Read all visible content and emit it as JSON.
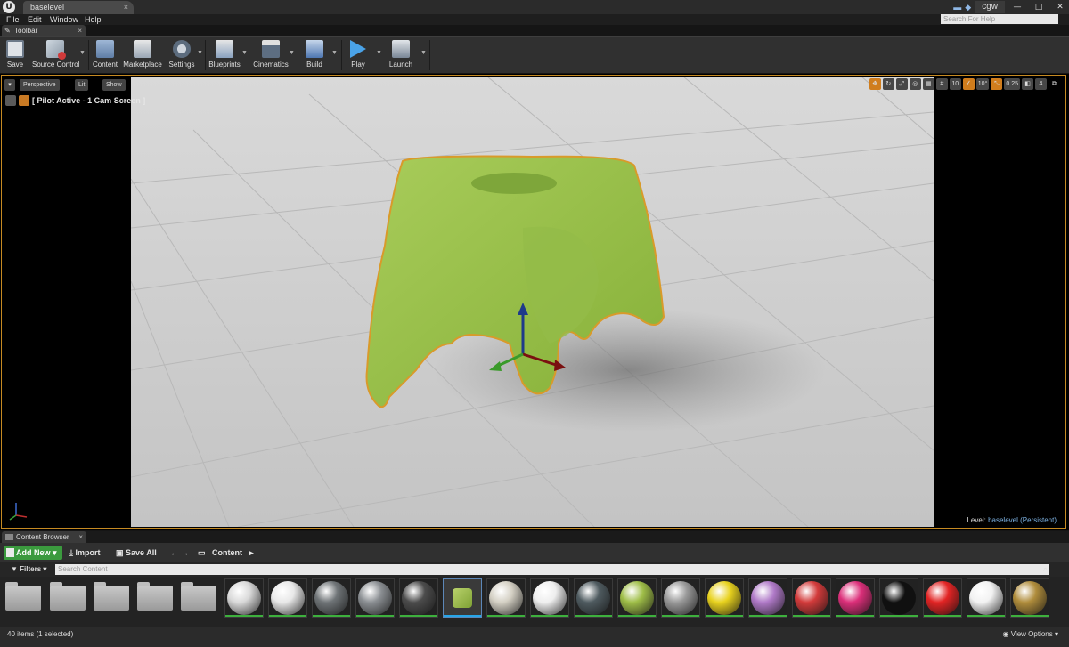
{
  "window": {
    "app_logo": "U",
    "doc_tab": "baselevel",
    "doc_tab_close": "×",
    "user": "cgw",
    "search_help_placeholder": "Search For Help",
    "minimize": "—",
    "maximize": "□",
    "close": "✕"
  },
  "menu": {
    "file": "File",
    "edit": "Edit",
    "window": "Window",
    "help": "Help"
  },
  "toolbar_tab": {
    "label": "Toolbar",
    "close": "×"
  },
  "toolbar": {
    "save": "Save",
    "source_control": "Source Control",
    "content": "Content",
    "marketplace": "Marketplace",
    "settings": "Settings",
    "blueprints": "Blueprints",
    "cinematics": "Cinematics",
    "build": "Build",
    "play": "Play",
    "launch": "Launch",
    "dropdown_glyph": "▼"
  },
  "viewport": {
    "options_glyph": "▾",
    "perspective": "Perspective",
    "lit": "Lit",
    "show": "Show",
    "pilot_label": "[ Pilot Active - 1 Cam Screen ]",
    "grid_snap": "10",
    "rot_snap": "10°",
    "scale_snap": "0.25",
    "cam_speed": "4",
    "level_label": "Level:",
    "level_name": "baselevel (Persistent)",
    "colors": {
      "selection_outline": "#c68a22",
      "object": "#9cc54c"
    }
  },
  "content_browser": {
    "tab_label": "Content Browser",
    "tab_close": "×",
    "add_new": "Add New",
    "import": "Import",
    "save_all": "Save All",
    "path_root": "Content",
    "filters": "Filters",
    "search_placeholder": "Search Content",
    "items_status": "40 items (1 selected)",
    "view_options": "View Options",
    "materials": [
      {
        "color": "#d9d9d9"
      },
      {
        "color": "#e8e8e8"
      },
      {
        "color": "#6f7477"
      },
      {
        "color": "#8b8f93"
      },
      {
        "color": "#4c4c4c"
      },
      {
        "color": "#b9d26c"
      },
      {
        "color": "#d4d0c4"
      },
      {
        "color": "#eeeeee"
      },
      {
        "color": "#4f5b60"
      },
      {
        "color": "#9fbe48"
      },
      {
        "color": "#9a9a9a"
      },
      {
        "color": "#e8d21e"
      },
      {
        "color": "#b07ac8"
      },
      {
        "color": "#d33b3b"
      },
      {
        "color": "#dc2f7a"
      },
      {
        "color": "#101010"
      },
      {
        "color": "#e22424"
      },
      {
        "color": "#f2f2f2"
      },
      {
        "color": "#b08d3c"
      }
    ]
  }
}
